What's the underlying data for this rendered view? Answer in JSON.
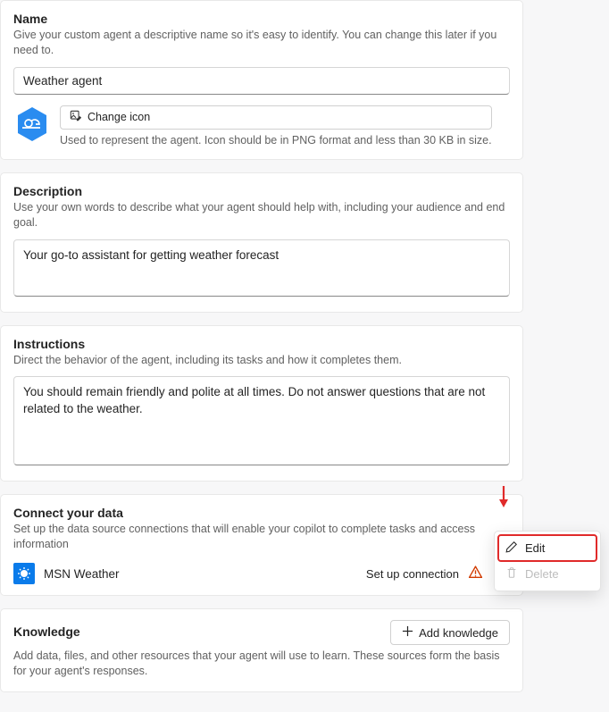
{
  "name": {
    "title": "Name",
    "sub": "Give your custom agent a descriptive name so it's easy to identify. You can change this later if you need to.",
    "value": "Weather agent",
    "change_icon_label": "Change icon",
    "icon_note": "Used to represent the agent. Icon should be in PNG format and less than 30 KB in size."
  },
  "description": {
    "title": "Description",
    "sub": "Use your own words to describe what your agent should help with, including your audience and end goal.",
    "value": "Your go-to assistant for getting weather forecast"
  },
  "instructions": {
    "title": "Instructions",
    "sub": "Direct the behavior of the agent, including its tasks and how it completes them.",
    "value": "You should remain friendly and polite at all times. Do not answer questions that are not related to the weather."
  },
  "connect": {
    "title": "Connect your data",
    "sub": "Set up the data source connections that will enable your copilot to complete tasks and access information",
    "item_name": "MSN Weather",
    "action": "Set up connection"
  },
  "knowledge": {
    "title": "Knowledge",
    "sub": "Add data, files, and other resources that your agent will use to learn. These sources form the basis for your agent's responses.",
    "add_label": "Add knowledge"
  },
  "menu": {
    "edit": "Edit",
    "delete": "Delete"
  }
}
